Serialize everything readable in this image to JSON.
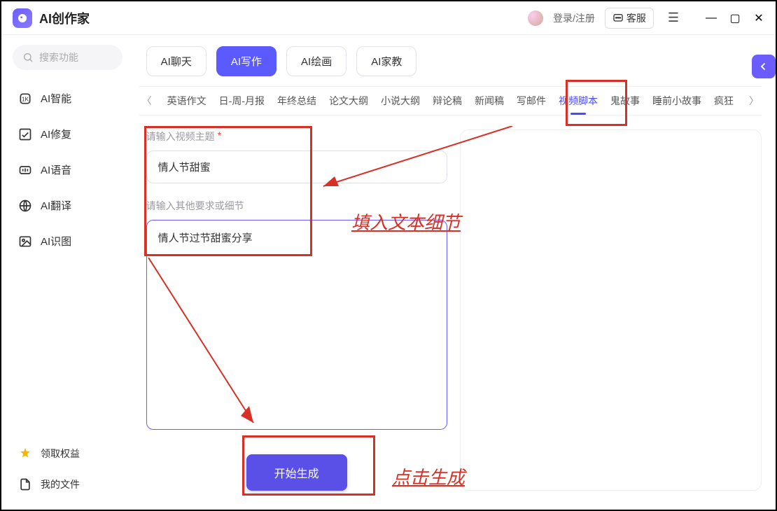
{
  "app": {
    "title": "AI创作家"
  },
  "header": {
    "login_text": "登录/注册",
    "kefu_label": "客服"
  },
  "sidebar": {
    "search_placeholder": "搜索功能",
    "items": [
      {
        "label": "AI智能"
      },
      {
        "label": "AI修复"
      },
      {
        "label": "AI语音"
      },
      {
        "label": "AI翻译"
      },
      {
        "label": "AI识图"
      }
    ],
    "footer": [
      {
        "label": "领取权益"
      },
      {
        "label": "我的文件"
      }
    ]
  },
  "main_tabs": [
    {
      "label": "AI聊天",
      "active": false
    },
    {
      "label": "AI写作",
      "active": true
    },
    {
      "label": "AI绘画",
      "active": false
    },
    {
      "label": "AI家教",
      "active": false
    }
  ],
  "sub_tabs": [
    {
      "label": "英语作文"
    },
    {
      "label": "日-周-月报"
    },
    {
      "label": "年终总结"
    },
    {
      "label": "论文大纲"
    },
    {
      "label": "小说大纲"
    },
    {
      "label": "辩论稿"
    },
    {
      "label": "新闻稿"
    },
    {
      "label": "写邮件"
    },
    {
      "label": "视频脚本",
      "active": true
    },
    {
      "label": "鬼故事"
    },
    {
      "label": "睡前小故事"
    },
    {
      "label": "疯狂"
    }
  ],
  "form": {
    "topic_label": "请输入视频主题",
    "topic_value": "情人节甜蜜",
    "detail_label": "请输入其他要求或细节",
    "detail_value": "情人节过节甜蜜分享",
    "generate_label": "开始生成"
  },
  "annotations": {
    "a1": "填入文本细节",
    "a2": "点击生成"
  }
}
